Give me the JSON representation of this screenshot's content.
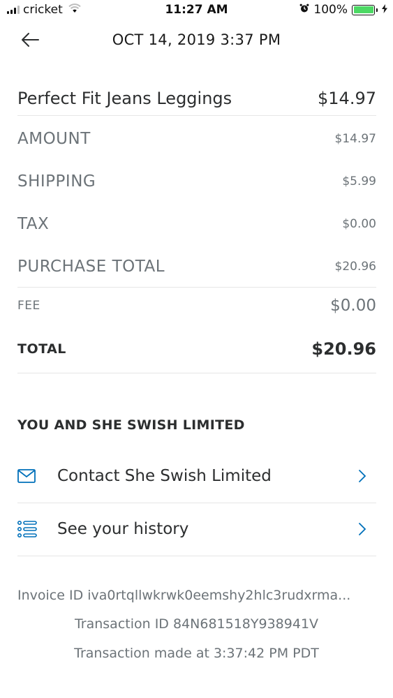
{
  "status_bar": {
    "carrier": "cricket",
    "time": "11:27 AM",
    "battery_percent": "100%",
    "battery_level": 1.0,
    "accent_battery": "#4cd964"
  },
  "header": {
    "title": "OCT 14, 2019  3:37 PM",
    "back_icon": "arrow-left-icon"
  },
  "item": {
    "name": "Perfect Fit Jeans Leggings",
    "price": "$14.97"
  },
  "breakdown": {
    "amount_label": "AMOUNT",
    "amount_value": "$14.97",
    "shipping_label": "SHIPPING",
    "shipping_value": "$5.99",
    "tax_label": "TAX",
    "tax_value": "$0.00",
    "purchase_total_label": "PURCHASE TOTAL",
    "purchase_total_value": "$20.96",
    "fee_label": "FEE",
    "fee_value": "$0.00",
    "total_label": "TOTAL",
    "total_value": "$20.96"
  },
  "merchant_section": {
    "title": "YOU AND SHE SWISH LIMITED",
    "links": [
      {
        "label": "Contact She Swish Limited",
        "icon": "envelope-icon"
      },
      {
        "label": "See your history",
        "icon": "list-icon"
      }
    ],
    "icon_color": "#0070ba"
  },
  "footer": {
    "invoice_id": "Invoice ID iva0rtqllwkrwk0eemshy2hlc3rudxrma...",
    "transaction_id": "Transaction ID 84N681518Y938941V",
    "transaction_time": "Transaction made at 3:37:42 PM PDT"
  }
}
